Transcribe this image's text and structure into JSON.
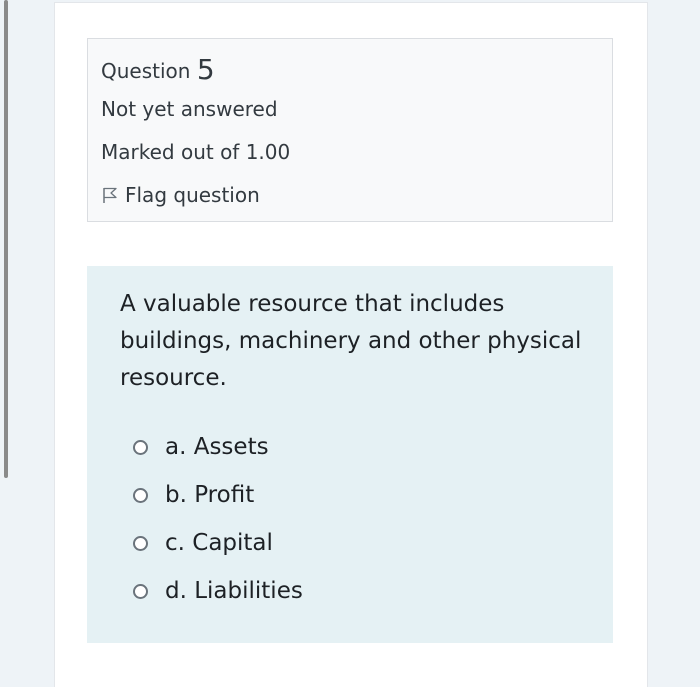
{
  "question_info": {
    "label": "Question",
    "number": "5",
    "state": "Not yet answered",
    "mark": "Marked out of 1.00",
    "flag_label": "Flag question"
  },
  "question": {
    "text": "A valuable resource that includes buildings, machinery and other physical resource."
  },
  "answers": [
    {
      "label": "a. Assets"
    },
    {
      "label": "b. Profit"
    },
    {
      "label": "c. Capital"
    },
    {
      "label": "d. Liabilities"
    }
  ]
}
